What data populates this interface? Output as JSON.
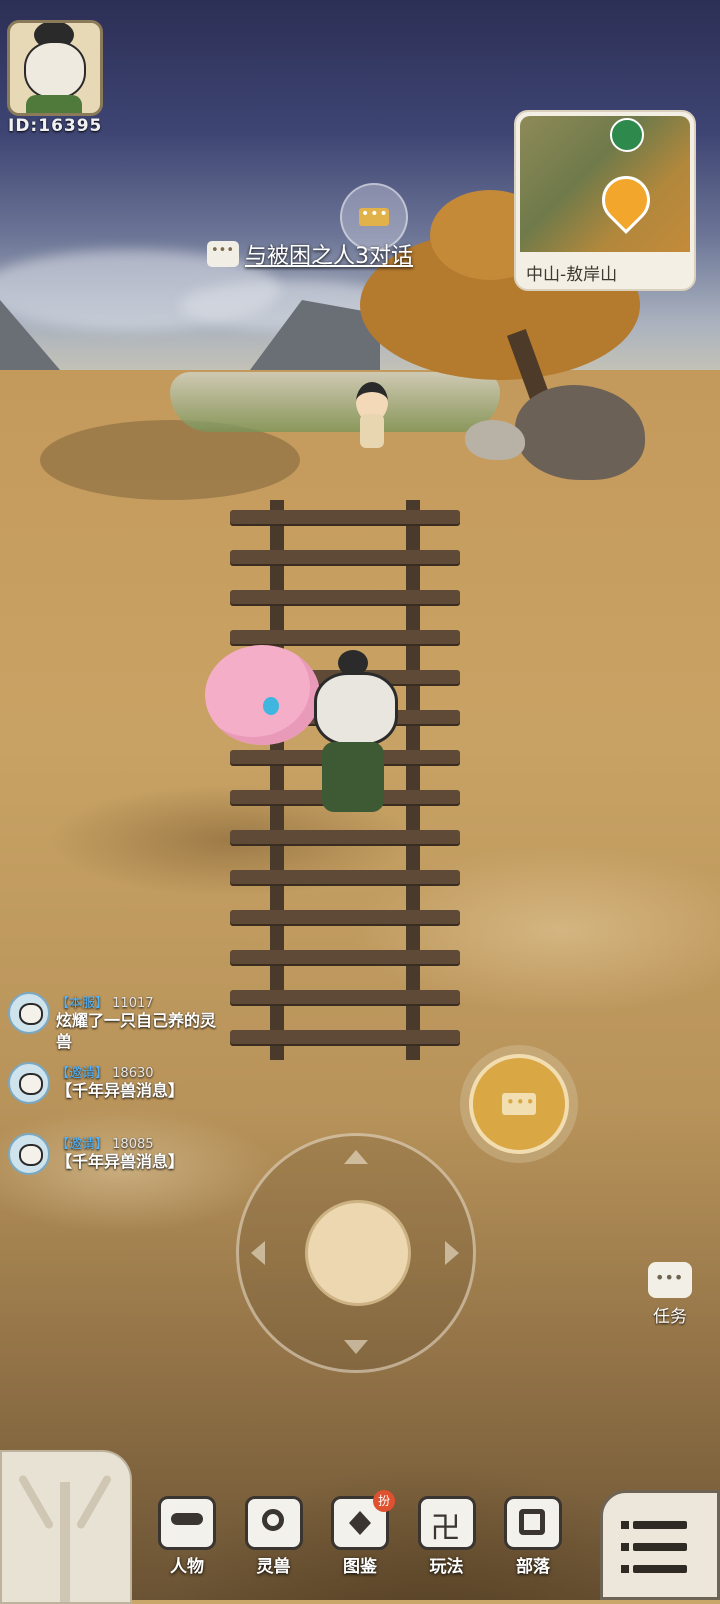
{
  "player": {
    "id_label": "ID:16395"
  },
  "quest": {
    "hint_text": "与被困之人3对话"
  },
  "minimap": {
    "location": "中山-敖岸山"
  },
  "chat": [
    {
      "tag": "【本服】",
      "user_id": "11017",
      "message": "炫耀了一只自己养的灵兽"
    },
    {
      "tag": "【邀请】",
      "user_id": "18630",
      "message": "【千年异兽消息】"
    },
    {
      "tag": "【邀请】",
      "user_id": "18085",
      "message": "【千年异兽消息】"
    }
  ],
  "side": {
    "task_label": "任务"
  },
  "nav": {
    "items": [
      {
        "label": "人物",
        "icon": "mask-icon"
      },
      {
        "label": "灵兽",
        "icon": "beast-icon"
      },
      {
        "label": "图鉴",
        "icon": "atlas-icon",
        "badge": "扮"
      },
      {
        "label": "玩法",
        "icon": "swastika-icon"
      },
      {
        "label": "部落",
        "icon": "tribe-icon"
      }
    ]
  },
  "colors": {
    "accent_gold": "#d9a744",
    "chat_tag_blue": "#4fb4ff",
    "badge_red": "#e0512f"
  }
}
